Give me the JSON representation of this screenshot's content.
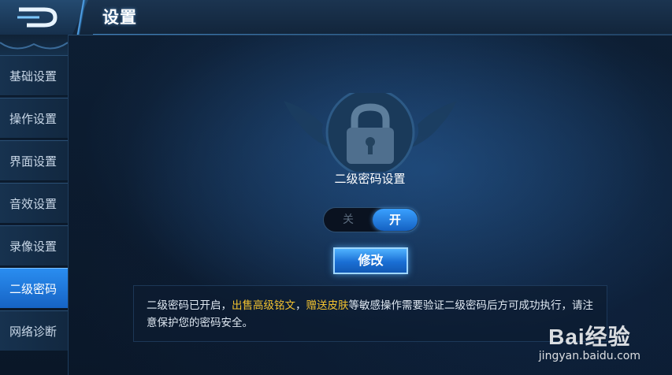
{
  "header": {
    "title": "设置"
  },
  "sidebar": {
    "items": [
      {
        "label": "基础设置"
      },
      {
        "label": "操作设置"
      },
      {
        "label": "界面设置"
      },
      {
        "label": "音效设置"
      },
      {
        "label": "录像设置"
      },
      {
        "label": "二级密码",
        "active": true
      },
      {
        "label": "网络诊断"
      }
    ]
  },
  "main": {
    "section_title": "二级密码设置",
    "toggle": {
      "off_label": "关",
      "on_label": "开",
      "state": "on"
    },
    "modify_label": "修改",
    "info": {
      "part1": "二级密码已开启，",
      "highlight1": "出售高级铭文",
      "sep": "，",
      "highlight2": "赠送皮肤",
      "part2": "等敏感操作需要验证二级密码后方可成功执行，请注意保护您的密码安全。"
    }
  },
  "watermark": {
    "logo": "Bai经验",
    "url": "jingyan.baidu.com"
  },
  "colors": {
    "accent": "#1f7ae0",
    "highlight": "#f2c230",
    "background": "#0c1a2c"
  }
}
